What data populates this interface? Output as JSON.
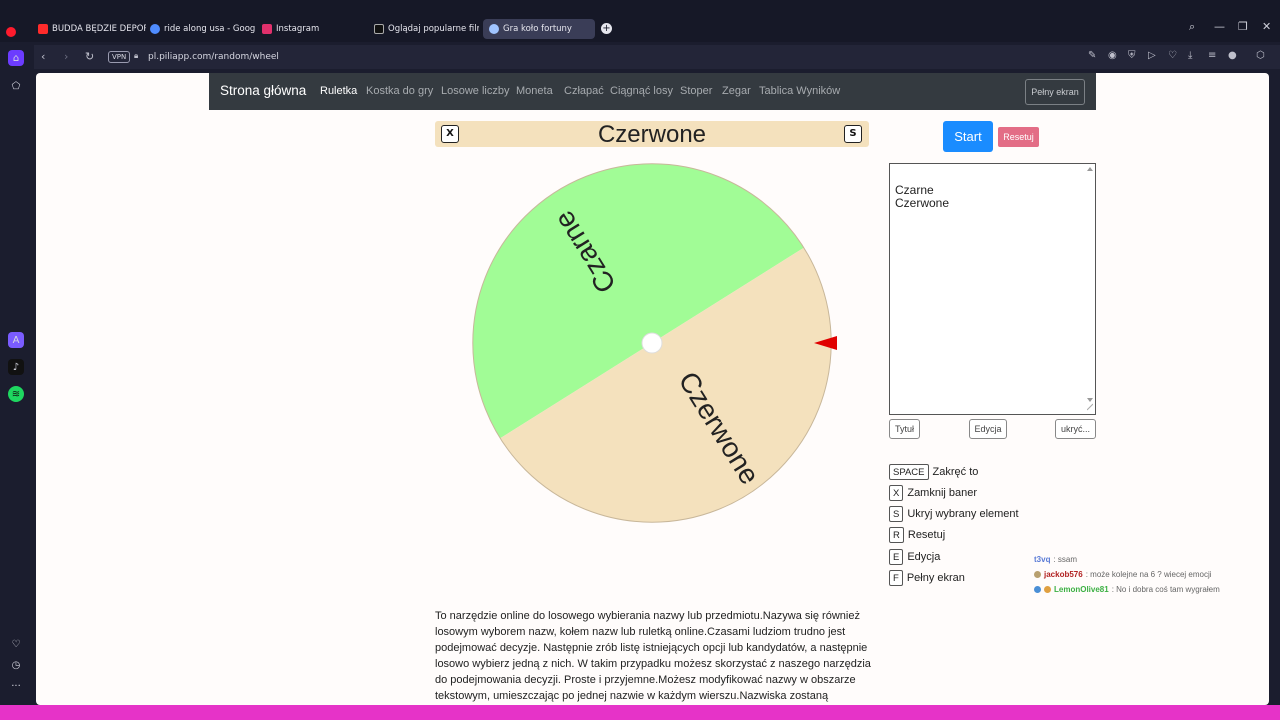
{
  "tabs": [
    {
      "label": "BUDDA BĘDZIE DEPORTO",
      "color": "#ff2b2b"
    },
    {
      "label": "ride along usa - Google S",
      "color": "#4f8cff"
    },
    {
      "label": "Instagram",
      "color": "#e1306c"
    },
    {
      "label": "Oglądaj popularne filmy |",
      "color": "#111111"
    },
    {
      "label": "Gra koło fortuny",
      "color": "#a0c4ff",
      "active": true
    }
  ],
  "address": {
    "vpn": "VPN",
    "url": "pl.piliapp.com/random/wheel"
  },
  "navbar": {
    "brand": "Strona główna",
    "links": [
      "Ruletka",
      "Kostka do gry",
      "Losowe liczby",
      "Moneta",
      "Człapać",
      "Ciągnąć losy",
      "Stoper",
      "Zegar",
      "Tablica Wyników"
    ],
    "fullscreen": "Pełny ekran"
  },
  "banner": {
    "title": "Czerwone",
    "close_key": "X",
    "hide_key": "S"
  },
  "wheel": {
    "segments": [
      {
        "label": "Czarne",
        "color": "#a1fc96"
      },
      {
        "label": "Czerwone",
        "color": "#f4e1bd"
      }
    ],
    "pointer_color": "#e00000"
  },
  "controls": {
    "start": "Start",
    "reset": "Resetuj"
  },
  "entries": [
    "Czarne",
    "Czerwone"
  ],
  "buttons": {
    "title": "Tytuł",
    "edit": "Edycja",
    "hide": "ukryć..."
  },
  "shortcuts": [
    {
      "key": "SPACE",
      "label": "Zakręć to"
    },
    {
      "key": "X",
      "label": "Zamknij baner"
    },
    {
      "key": "S",
      "label": "Ukryj wybrany element"
    },
    {
      "key": "R",
      "label": "Resetuj"
    },
    {
      "key": "E",
      "label": "Edycja"
    },
    {
      "key": "F",
      "label": "Pełny ekran"
    }
  ],
  "description": "To narzędzie online do losowego wybierania nazwy lub przedmiotu.Nazywa się również losowym wyborem nazw, kołem nazw lub ruletką online.Czasami ludziom trudno jest podejmować decyzje. Następnie zrób listę istniejących opcji lub kandydatów, a następnie losowo wybierz jedną z nich. W takim przypadku możesz skorzystać z naszego narzędzia do podejmowania decyzji. Proste i przyjemne.Możesz modyfikować nazwy w obszarze tekstowym, umieszczając po jednej nazwie w każdym wierszu.Nazwiska zostaną narysowane",
  "chat": [
    {
      "user": "t3vq",
      "text": ": ssam",
      "color": "#5a7bd6"
    },
    {
      "user": "jackob576",
      "text": ": może kolejne na 6 ? wiecej emocji",
      "color": "#b22222"
    },
    {
      "user": "LemonOlive81",
      "text": ": No i dobra coś tam wygrałem",
      "color": "#3cb043"
    }
  ]
}
